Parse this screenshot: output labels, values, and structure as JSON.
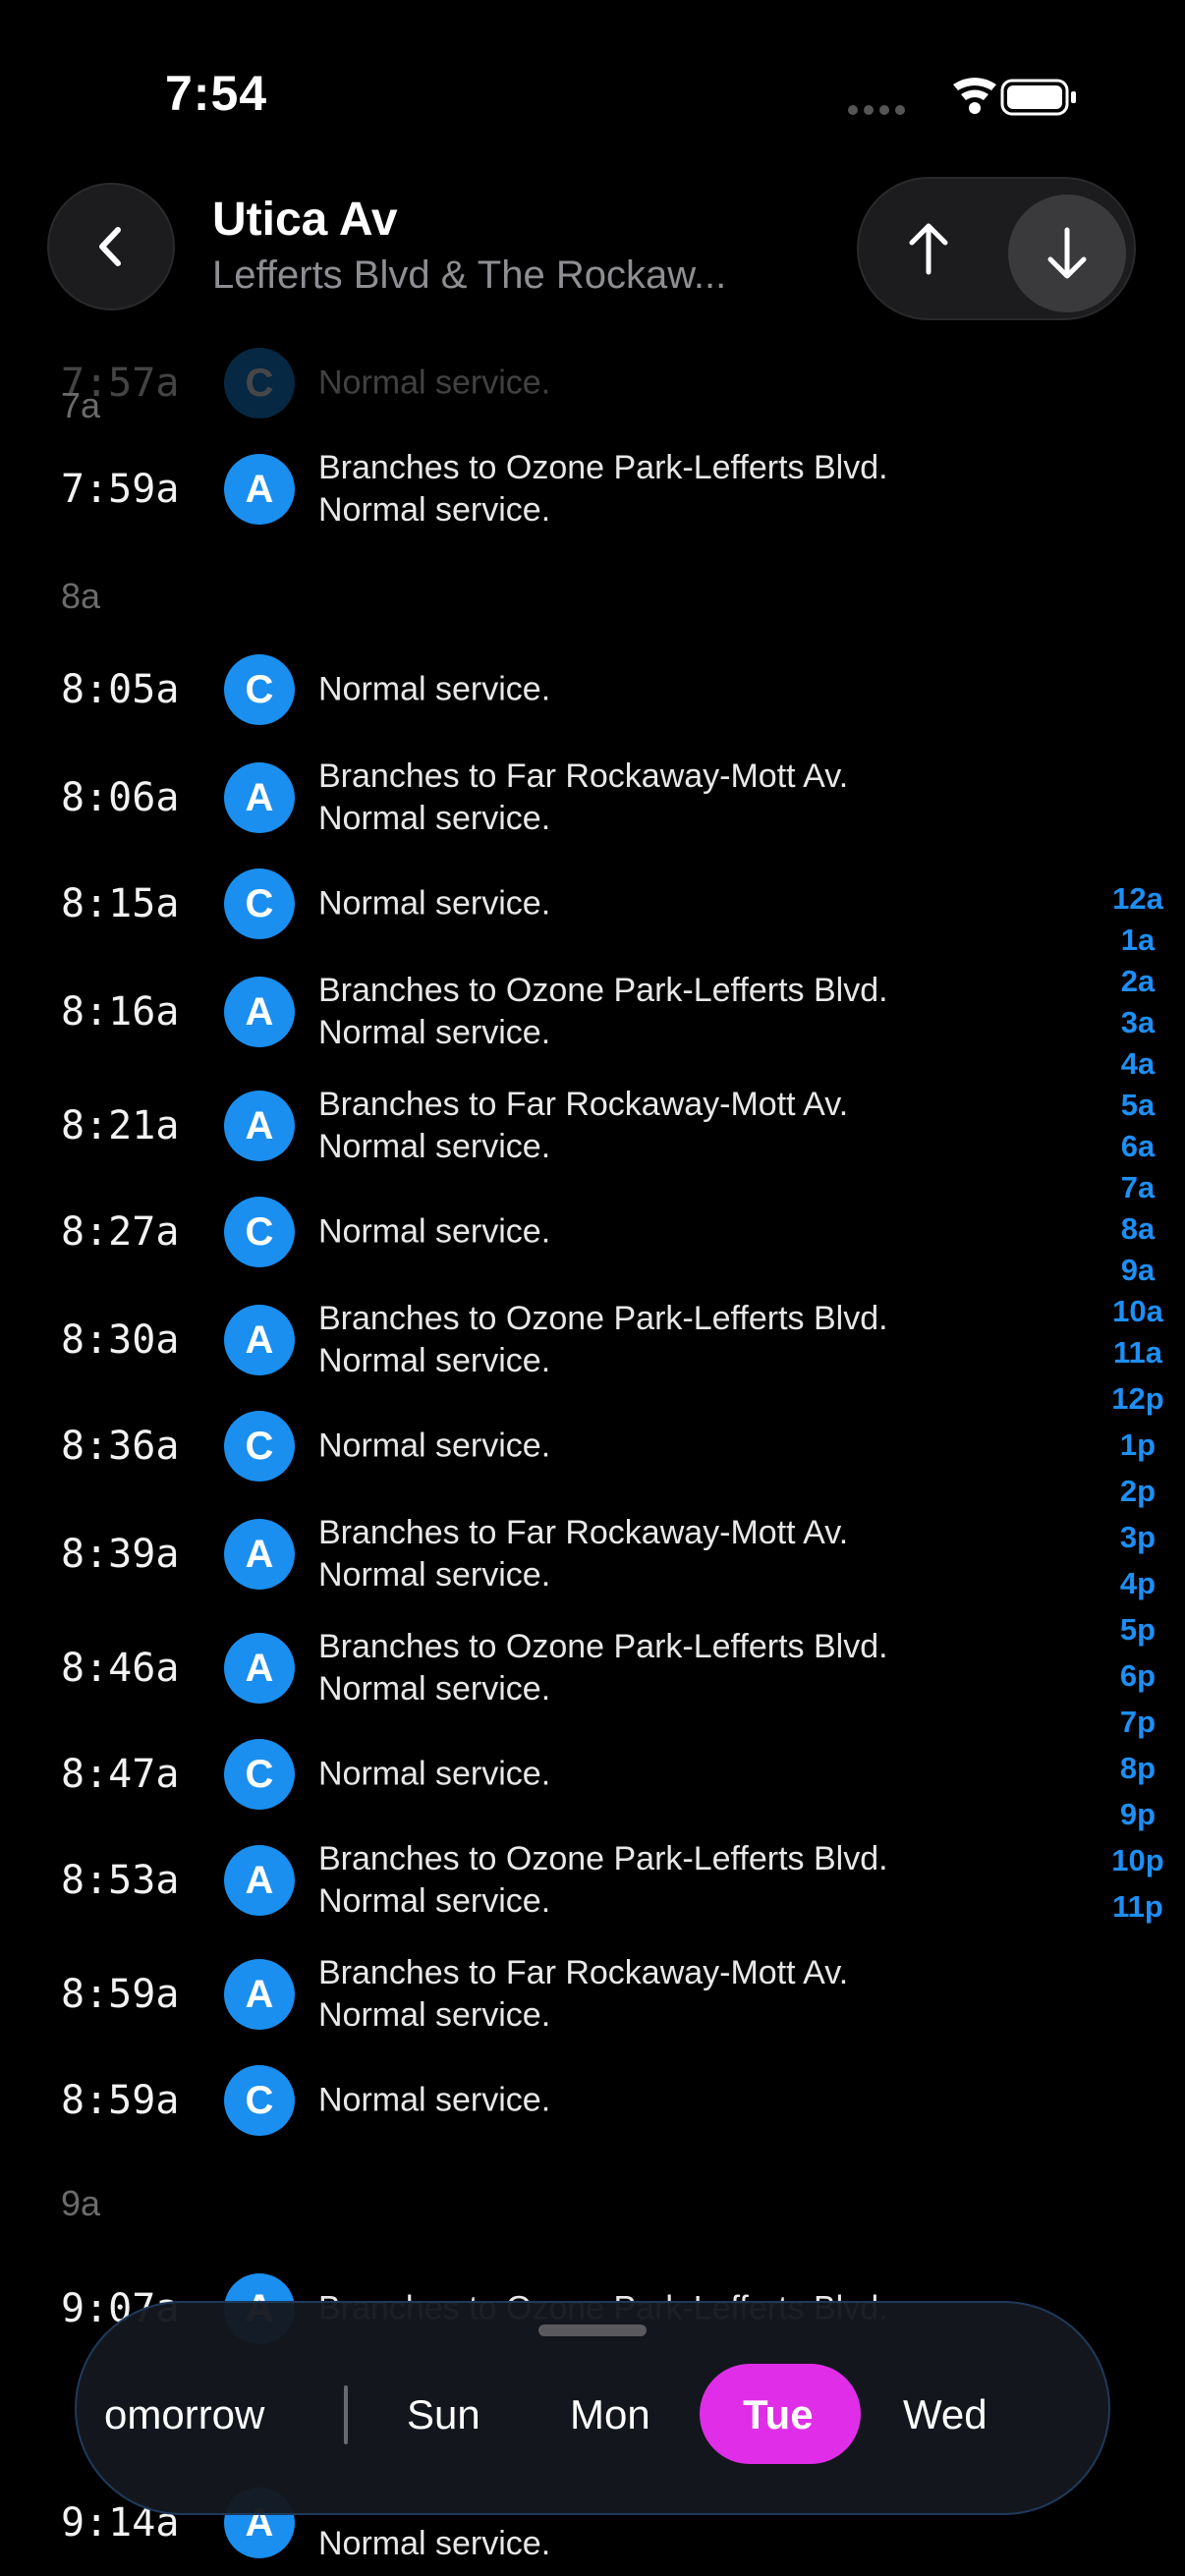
{
  "status_bar": {
    "time": "7:54"
  },
  "header": {
    "title": "Utica Av",
    "subtitle": "Lefferts Blvd & The Rockaw...",
    "direction_up_icon": "arrow-up-icon",
    "direction_down_icon": "arrow-down-icon"
  },
  "schedule": {
    "ghost_row": {
      "time": "7:57a",
      "line": "C",
      "desc": "Normal service."
    },
    "hour_7": "7a",
    "hour_8": "8a",
    "hour_9": "9a",
    "rows": [
      {
        "time": "7:59a",
        "line": "A",
        "line1": "Branches to Ozone Park-Lefferts Blvd.",
        "line2": "Normal service."
      },
      {
        "time": "8:05a",
        "line": "C",
        "line1": "Normal service.",
        "line2": ""
      },
      {
        "time": "8:06a",
        "line": "A",
        "line1": "Branches to Far Rockaway-Mott Av.",
        "line2": "Normal service."
      },
      {
        "time": "8:15a",
        "line": "C",
        "line1": "Normal service.",
        "line2": ""
      },
      {
        "time": "8:16a",
        "line": "A",
        "line1": "Branches to Ozone Park-Lefferts Blvd.",
        "line2": "Normal service."
      },
      {
        "time": "8:21a",
        "line": "A",
        "line1": "Branches to Far Rockaway-Mott Av.",
        "line2": "Normal service."
      },
      {
        "time": "8:27a",
        "line": "C",
        "line1": "Normal service.",
        "line2": ""
      },
      {
        "time": "8:30a",
        "line": "A",
        "line1": "Branches to Ozone Park-Lefferts Blvd.",
        "line2": "Normal service."
      },
      {
        "time": "8:36a",
        "line": "C",
        "line1": "Normal service.",
        "line2": ""
      },
      {
        "time": "8:39a",
        "line": "A",
        "line1": "Branches to Far Rockaway-Mott Av.",
        "line2": "Normal service."
      },
      {
        "time": "8:46a",
        "line": "A",
        "line1": "Branches to Ozone Park-Lefferts Blvd.",
        "line2": "Normal service."
      },
      {
        "time": "8:47a",
        "line": "C",
        "line1": "Normal service.",
        "line2": ""
      },
      {
        "time": "8:53a",
        "line": "A",
        "line1": "Branches to Ozone Park-Lefferts Blvd.",
        "line2": "Normal service."
      },
      {
        "time": "8:59a",
        "line": "A",
        "line1": "Branches to Far Rockaway-Mott Av.",
        "line2": "Normal service."
      },
      {
        "time": "8:59a",
        "line": "C",
        "line1": "Normal service.",
        "line2": ""
      },
      {
        "time": "9:07a",
        "line": "A",
        "line1": "Branches to Ozone Park-Lefferts Blvd.",
        "line2": ""
      },
      {
        "time": "9:14a",
        "line": "A",
        "line1": "",
        "line2": "Normal service."
      }
    ]
  },
  "hour_index": [
    "12a",
    "1a",
    "2a",
    "3a",
    "4a",
    "5a",
    "6a",
    "7a",
    "8a",
    "9a",
    "10a",
    "11a",
    "12p",
    "1p",
    "2p",
    "3p",
    "4p",
    "5p",
    "6p",
    "7p",
    "8p",
    "9p",
    "10p",
    "11p"
  ],
  "day_selector": {
    "items": [
      "omorrow",
      "Sun",
      "Mon",
      "Tue",
      "Wed"
    ],
    "selected": "Tue"
  },
  "colors": {
    "accent_blue": "#1a8ff0",
    "index_blue": "#1e8ff5",
    "selected_day": "#e02ee8",
    "background": "#000000"
  }
}
